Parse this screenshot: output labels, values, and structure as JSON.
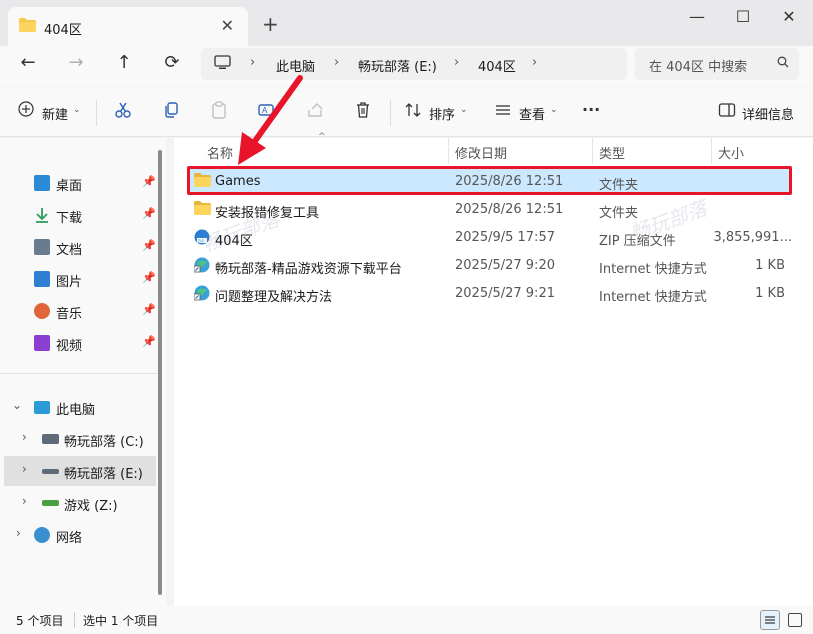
{
  "window": {
    "tab_title": "404区",
    "new_tab": "+",
    "close_tab": "✕",
    "minimize": "—",
    "maximize": "☐",
    "close": "✕"
  },
  "nav": {
    "back": "←",
    "forward": "→",
    "up": "↑",
    "refresh": "⟳"
  },
  "address": {
    "segments": [
      "此电脑",
      "畅玩部落 (E:)",
      "404区"
    ],
    "separator": "›"
  },
  "search": {
    "placeholder": "在 404区 中搜索"
  },
  "toolbar": {
    "new_label": "新建",
    "sort_label": "排序",
    "view_label": "查看",
    "more": "···",
    "details_label": "详细信息"
  },
  "sidebar": {
    "quick_access": [
      {
        "label": "桌面",
        "icon": "desktop-icon",
        "color": "#2b8ad6"
      },
      {
        "label": "下载",
        "icon": "download-icon",
        "color": "#2a9d5c"
      },
      {
        "label": "文档",
        "icon": "document-icon",
        "color": "#6b7b8f"
      },
      {
        "label": "图片",
        "icon": "pictures-icon",
        "color": "#2f7fd3"
      },
      {
        "label": "音乐",
        "icon": "music-icon",
        "color": "#e0663a"
      },
      {
        "label": "视频",
        "icon": "video-icon",
        "color": "#8a3fd1"
      }
    ],
    "this_pc": "此电脑",
    "drives": [
      {
        "label": "畅玩部落 (C:)"
      },
      {
        "label": "畅玩部落 (E:)"
      },
      {
        "label": "游戏 (Z:)"
      }
    ],
    "network": "网络"
  },
  "columns": {
    "name": "名称",
    "date": "修改日期",
    "type": "类型",
    "size": "大小"
  },
  "files": [
    {
      "name": "Games",
      "date": "2025/8/26 12:51",
      "type": "文件夹",
      "size": ""
    },
    {
      "name": "安装报错修复工具",
      "date": "2025/8/26 12:51",
      "type": "文件夹",
      "size": ""
    },
    {
      "name": "404区",
      "date": "2025/9/5 17:57",
      "type": "ZIP 压缩文件",
      "size": "3,855,991..."
    },
    {
      "name": "畅玩部落-精品游戏资源下载平台",
      "date": "2025/5/27 9:20",
      "type": "Internet 快捷方式",
      "size": "1 KB"
    },
    {
      "name": "问题整理及解决方法",
      "date": "2025/5/27 9:21",
      "type": "Internet 快捷方式",
      "size": "1 KB"
    }
  ],
  "watermarks": [
    "畅玩部落",
    "畅玩部落"
  ],
  "status": {
    "count": "5 个项目",
    "selected": "选中 1 个项目"
  },
  "colors": {
    "selection": "#cce8ff",
    "highlight_box": "#e8142a",
    "folder": "#f7c948",
    "arrow": "#e8142a"
  }
}
